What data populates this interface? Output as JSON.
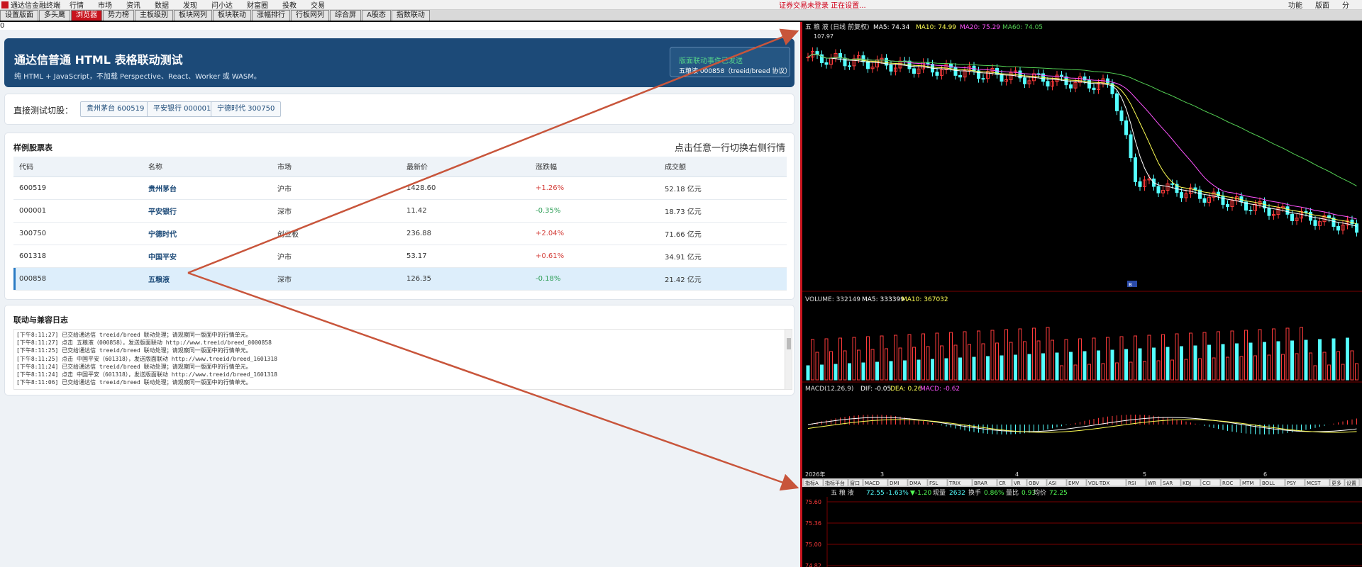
{
  "topbar": {
    "app_title": "通达信金融终端",
    "menu": [
      "行情",
      "市场",
      "资讯",
      "数据",
      "发现",
      "问小达",
      "财富圈",
      "投教",
      "交易"
    ],
    "status": "证券交易未登录  正在设置...",
    "right": [
      "功能",
      "版面",
      "分"
    ]
  },
  "tabs": [
    "设置版面",
    "多头鹰",
    "浏览器",
    "势力榜",
    "主板级别",
    "板块网列",
    "板块联动",
    "涨幅排行",
    "行板网列",
    "综合屏",
    "A股态",
    "指数联动"
  ],
  "active_tab": 2,
  "zero_label": "0",
  "banner": {
    "title": "通达信普通 HTML 表格联动测试",
    "subtitle": "纯 HTML + JavaScript，不加载 Perspective、React、Worker 或 WASM。",
    "box_title": "版面联动事件已发送",
    "box_sub": "五粮液 000858（treeid/breed 协议）"
  },
  "quick": {
    "label": "直接测试切股：",
    "buttons": [
      "贵州茅台 600519",
      "平安银行 000001",
      "宁德时代 300750"
    ]
  },
  "stock_table": {
    "title": "样例股票表",
    "hint": "点击任意一行切换右侧行情",
    "headers": [
      "代码",
      "名称",
      "市场",
      "最新价",
      "涨跌幅",
      "成交额"
    ],
    "rows": [
      [
        "600519",
        "贵州茅台",
        "沪市",
        "1428.60",
        "+1.26%",
        "52.18 亿元"
      ],
      [
        "000001",
        "平安银行",
        "深市",
        "11.42",
        "-0.35%",
        "18.73 亿元"
      ],
      [
        "300750",
        "宁德时代",
        "创业板",
        "236.88",
        "+2.04%",
        "71.66 亿元"
      ],
      [
        "601318",
        "中国平安",
        "沪市",
        "53.17",
        "+0.61%",
        "34.91 亿元"
      ],
      [
        "000858",
        "五粮液",
        "深市",
        "126.35",
        "-0.18%",
        "21.42 亿元"
      ]
    ],
    "selected": 4
  },
  "log": {
    "title": "联动与兼容日志",
    "lines": [
      "[下午8:11:27] 已交给通达信 treeid/breed 联动处理；请观察同一版面中的行情单元。",
      "[下午8:11:27] 点击 五粮液（000858），发送版面联动 http://www.treeid/breed_0000858",
      "[下午8:11:25] 已交给通达信 treeid/breed 联动处理；请观察同一版面中的行情单元。",
      "[下午8:11:25] 点击 中国平安（601318），发送版面联动 http://www.treeid/breed_1601318",
      "[下午8:11:24] 已交给通达信 treeid/breed 联动处理；请观察同一版面中的行情单元。",
      "[下午8:11:24] 点击 中国平安（601318），发送版面联动 http://www.treeid/breed_1601318",
      "[下午8:11:06] 已交给通达信 treeid/breed 联动处理；请观察同一版面中的行情单元。"
    ]
  },
  "kline": {
    "header": "五 粮 液 (日线 前复权)",
    "ma5": "MA5: 74.34",
    "ma10": "MA10: 74.99",
    "ma20": "MA20: 75.29",
    "ma60": "MA60: 74.05",
    "high": "107.97",
    "badge": "B"
  },
  "volume": {
    "header": "VOLUME: 332149",
    "ma5": "MA5: 333399",
    "ma10": "MA10: 367032"
  },
  "macd": {
    "header": "MACD(12,26,9)",
    "dif": "DIF: -0.05",
    "dea": "DEA: 0.26",
    "macd": "MACD: -0.62"
  },
  "date_axis": [
    "2026年",
    "3",
    "4",
    "5",
    "6"
  ],
  "indicator_tabs": [
    "指标A",
    "指标平台",
    "窗口",
    "MACD",
    "DMI",
    "DMA",
    "FSL",
    "TRIX",
    "BRAR",
    "CR",
    "VR",
    "OBV",
    "ASI",
    "EMV",
    "VOL-TDX",
    "RSI",
    "WR",
    "SAR",
    "KDJ",
    "CCI",
    "ROC",
    "MTM",
    "BOLL",
    "PSY",
    "MCST",
    "更多",
    "设置"
  ],
  "intraday": {
    "name": "五 粮 液",
    "price": "72.55",
    "pct": "-1.63%",
    "chg": "▼-1.20",
    "now_label": "现量",
    "now": "2632",
    "turn_label": "换手",
    "turn": "0.86%",
    "ratio_label": "量比",
    "ratio": "0.93",
    "avg_label": "均价",
    "avg": "72.25",
    "prices": [
      "75.60",
      "75.36",
      "75.00",
      "74.82"
    ]
  },
  "colors": {
    "brand": "#c8141e",
    "up": "#ff3b3b",
    "down": "#54ffff",
    "ma5": "#ffffff",
    "ma10": "#ffff54",
    "ma20": "#ff54ff",
    "ma60": "#54d054"
  }
}
